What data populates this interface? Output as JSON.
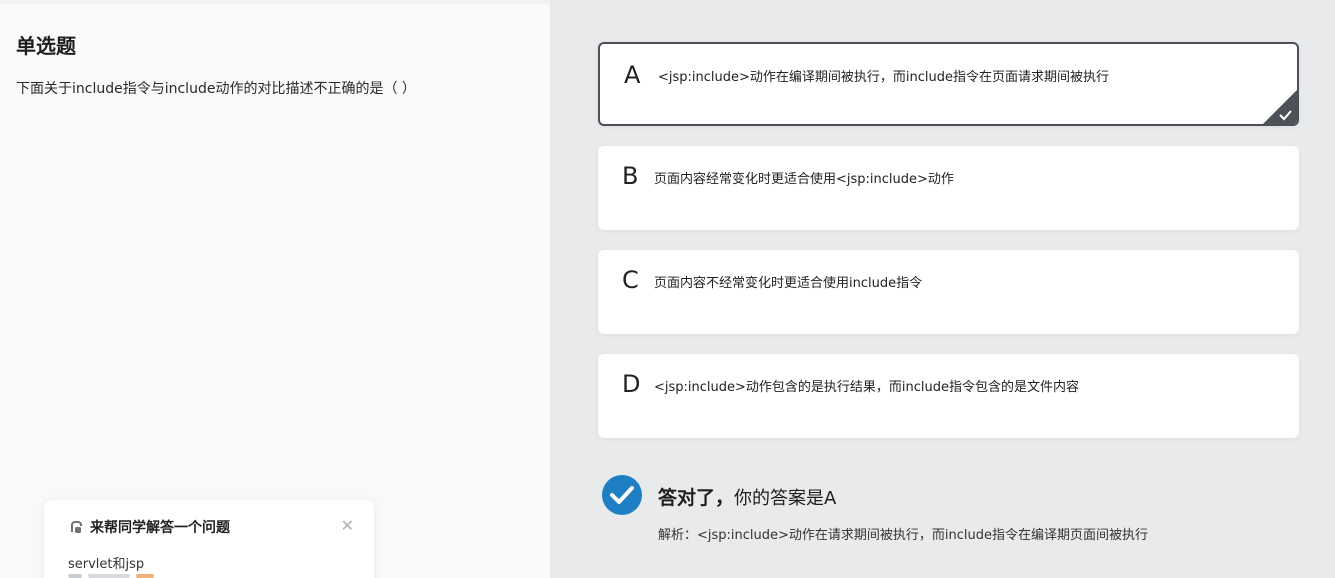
{
  "question": {
    "type_label": "单选题",
    "text": "下面关于include指令与include动作的对比描述不正确的是（  ）"
  },
  "options": [
    {
      "letter": "A",
      "text": "<jsp:include>动作在编译期间被执行，而include指令在页面请求期间被执行",
      "selected": true
    },
    {
      "letter": "B",
      "text": "页面内容经常变化时更适合使用<jsp:include>动作",
      "selected": false
    },
    {
      "letter": "C",
      "text": "页面内容不经常变化时更适合使用include指令",
      "selected": false
    },
    {
      "letter": "D",
      "text": "<jsp:include>动作包含的是执行结果，而include指令包含的是文件内容",
      "selected": false
    }
  ],
  "result": {
    "status_text": "答对了，",
    "answer_text": "你的答案是A",
    "analysis": "解析：<jsp:include>动作在请求期间被执行，而include指令在编译期页面间被执行"
  },
  "help_card": {
    "title": "来帮同学解答一个问题",
    "subtitle": "servlet和jsp",
    "close_symbol": "✕"
  },
  "colors": {
    "accent_blue": "#1e7fc4",
    "selected_border": "#4d5157",
    "left_bg": "#f8f9fb",
    "right_bg": "#e8eaec"
  }
}
